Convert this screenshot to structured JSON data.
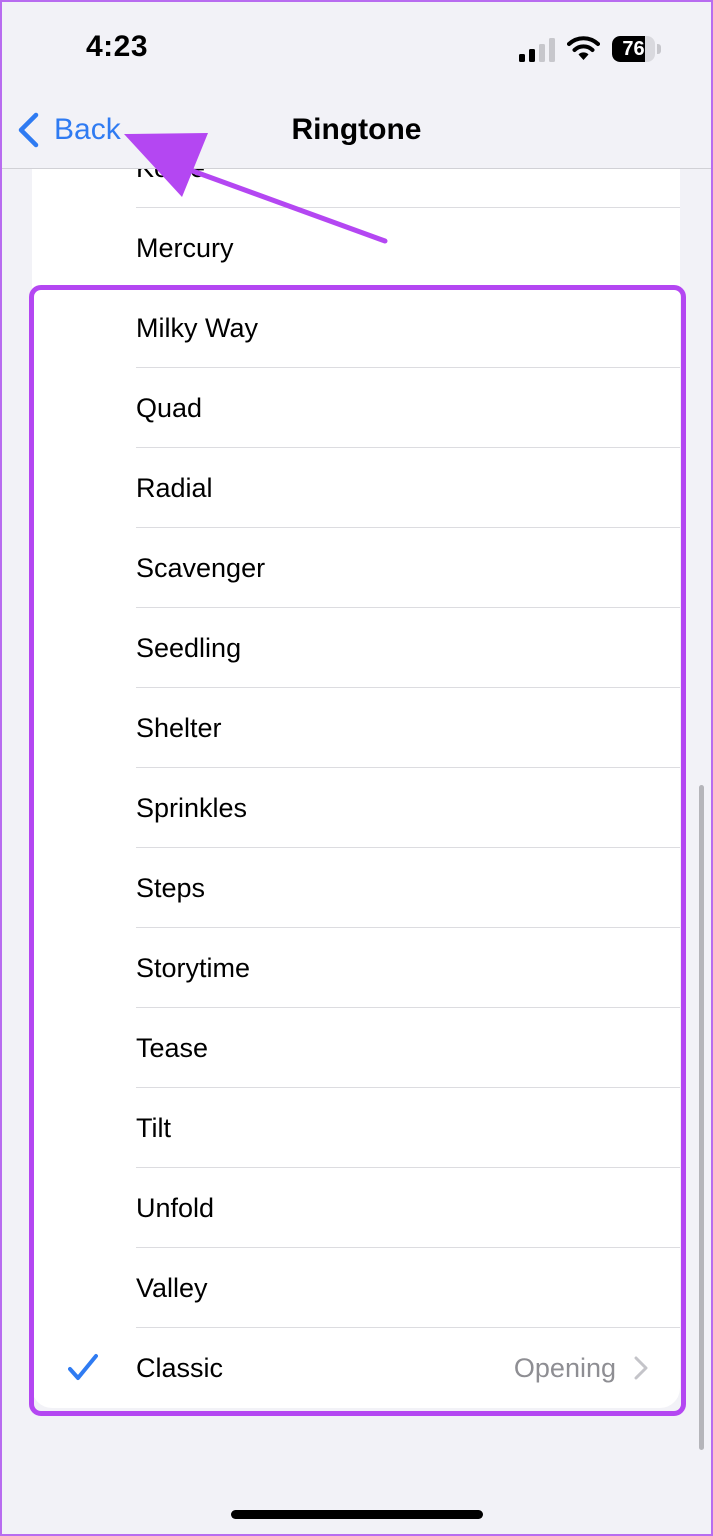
{
  "status_bar": {
    "time": "4:23",
    "battery_level": "76",
    "battery_fraction": 0.76
  },
  "nav": {
    "back_label": "Back",
    "title": "Ringtone"
  },
  "list": {
    "items": [
      {
        "label": "Kettle",
        "selected": false
      },
      {
        "label": "Mercury",
        "selected": false
      },
      {
        "label": "Milky Way",
        "selected": false
      },
      {
        "label": "Quad",
        "selected": false
      },
      {
        "label": "Radial",
        "selected": false
      },
      {
        "label": "Scavenger",
        "selected": false
      },
      {
        "label": "Seedling",
        "selected": false
      },
      {
        "label": "Shelter",
        "selected": false
      },
      {
        "label": "Sprinkles",
        "selected": false
      },
      {
        "label": "Steps",
        "selected": false
      },
      {
        "label": "Storytime",
        "selected": false
      },
      {
        "label": "Tease",
        "selected": false
      },
      {
        "label": "Tilt",
        "selected": false
      },
      {
        "label": "Unfold",
        "selected": false
      },
      {
        "label": "Valley",
        "selected": false
      },
      {
        "label": "Classic",
        "selected": true,
        "value": "Opening"
      }
    ]
  },
  "colors": {
    "accent": "#2f7bf2",
    "annotation": "#b447f2",
    "background": "#f2f2f7"
  },
  "icons": {
    "back": "chevron-left-icon",
    "selected": "checkmark-icon",
    "disclosure": "chevron-right-icon"
  }
}
